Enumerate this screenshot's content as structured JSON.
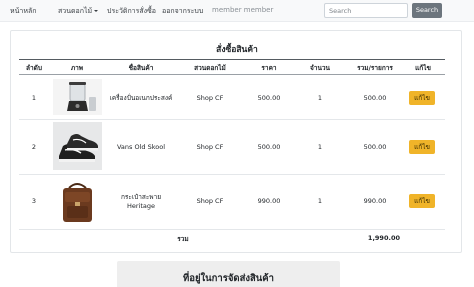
{
  "navbar": {
    "home": "หน้าหลัก",
    "products": "สวนดอกไม้",
    "history": "ประวัติการสั่งซื้อ",
    "logout": "ออกจากระบบ",
    "member": "member member",
    "search_placeholder": "Search",
    "search_button": "Search"
  },
  "order": {
    "title": "สั่งซื้อสินค้า",
    "columns": [
      "ลำดับ",
      "ภาพ",
      "ชื่อสินค้า",
      "สวนดอกไม้",
      "ราคา",
      "จำนวน",
      "รวม/รายการ",
      "แก้ไข"
    ],
    "rows": [
      {
        "no": "1",
        "image": "blender-image",
        "name": "เครื่องปั่นอเนกประสงค์",
        "shop": "Shop CF",
        "price": "500.00",
        "qty": "1",
        "subtotal": "500.00",
        "edit": "แก้ไข"
      },
      {
        "no": "2",
        "image": "sneakers-image",
        "name": "Vans Old Skool",
        "shop": "Shop CF",
        "price": "500.00",
        "qty": "1",
        "subtotal": "500.00",
        "edit": "แก้ไข"
      },
      {
        "no": "3",
        "image": "leather-bag-image",
        "name": "กระเป๋าสะพาย Heritage",
        "shop": "Shop CF",
        "price": "990.00",
        "qty": "1",
        "subtotal": "990.00",
        "edit": "แก้ไข"
      }
    ],
    "total_label": "รวม",
    "total_value": "1,990.00"
  },
  "shipping": {
    "title": "ที่อยู่ในการจัดส่งสินค้า"
  },
  "colors": {
    "edit_button": "#f0b429",
    "search_button": "#6c757d",
    "navbar_bg": "#f8f9fa"
  }
}
